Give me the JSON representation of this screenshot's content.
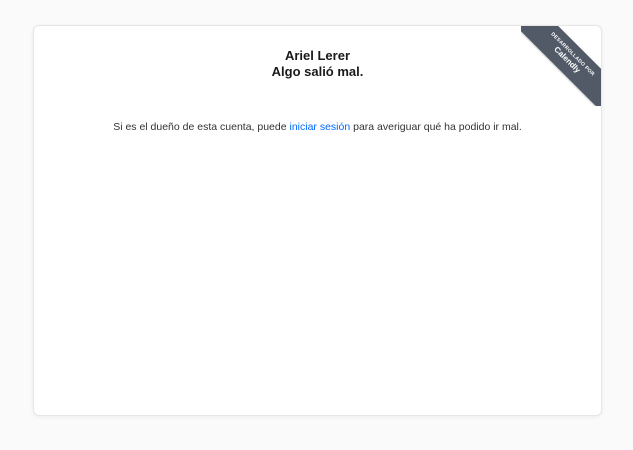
{
  "header": {
    "owner_name": "Ariel Lerer",
    "error_title": "Algo salió mal."
  },
  "message": {
    "before_link": "Si es el dueño de esta cuenta, puede ",
    "link_text": "iniciar sesión",
    "after_link": " para averiguar qué ha podido ir mal."
  },
  "ribbon": {
    "small_text": "DESARROLLADO POR",
    "brand": "Calendly"
  },
  "colors": {
    "link": "#0069ff",
    "ribbon": "#515a66"
  }
}
